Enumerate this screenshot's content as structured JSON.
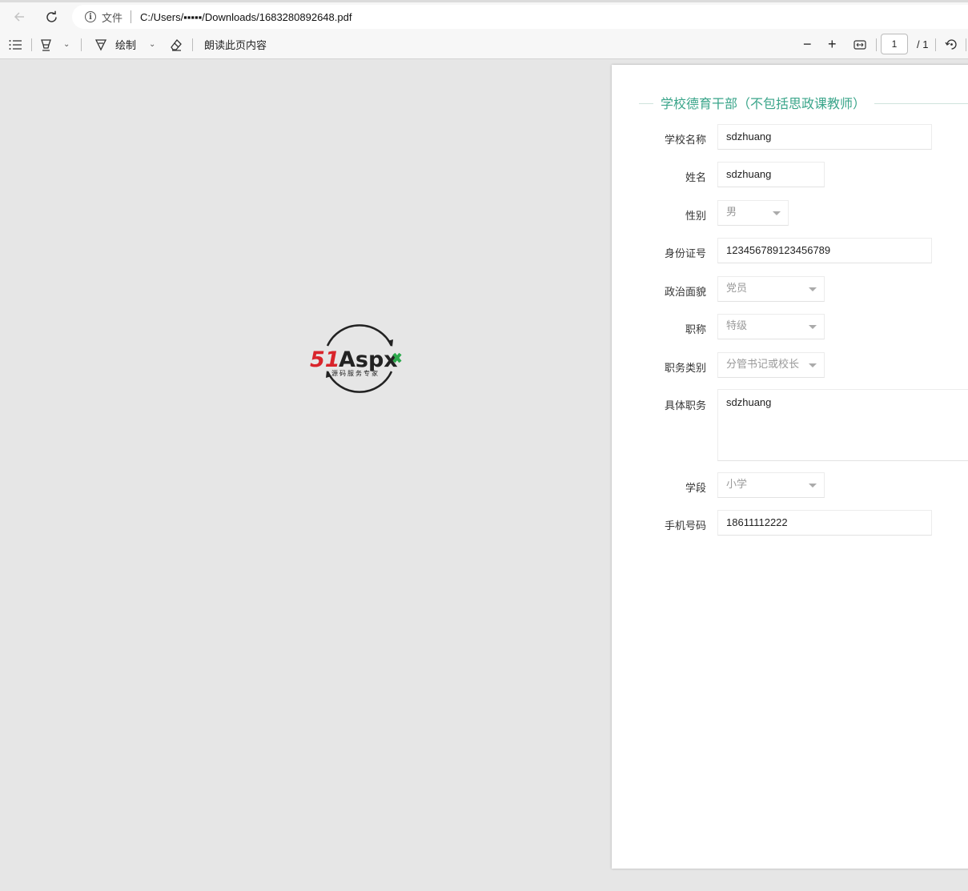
{
  "browser": {
    "file_label": "文件",
    "url": "C:/Users/▪▪▪▪▪/Downloads/1683280892648.pdf"
  },
  "pdf_toolbar": {
    "draw_label": "绘制",
    "read_aloud_label": "朗读此页内容",
    "page_current": "1",
    "page_total": "/ 1"
  },
  "logo": {
    "brand": "51Aspx",
    "tagline": "源码服务专家",
    "colors": {
      "red": "#d9242b",
      "green": "#2aa84a",
      "dark": "#222222"
    }
  },
  "form": {
    "section_title": "学校德育干部（不包括思政课教师）",
    "accent_color": "#3aa58a",
    "fields": [
      {
        "label": "学校名称",
        "value": "sdzhuang"
      },
      {
        "label": "姓名",
        "value": "sdzhuang"
      },
      {
        "label": "性别",
        "value": "男"
      },
      {
        "label": "身份证号",
        "value": "123456789123456789"
      },
      {
        "label": "政治面貌",
        "value": "党员"
      },
      {
        "label": "职称",
        "value": "特级"
      },
      {
        "label": "职务类别",
        "value": "分管书记或校长"
      },
      {
        "label": "具体职务",
        "value": "sdzhuang"
      },
      {
        "label": "学段",
        "value": "小学"
      },
      {
        "label": "手机号码",
        "value": "18611112222"
      }
    ]
  }
}
